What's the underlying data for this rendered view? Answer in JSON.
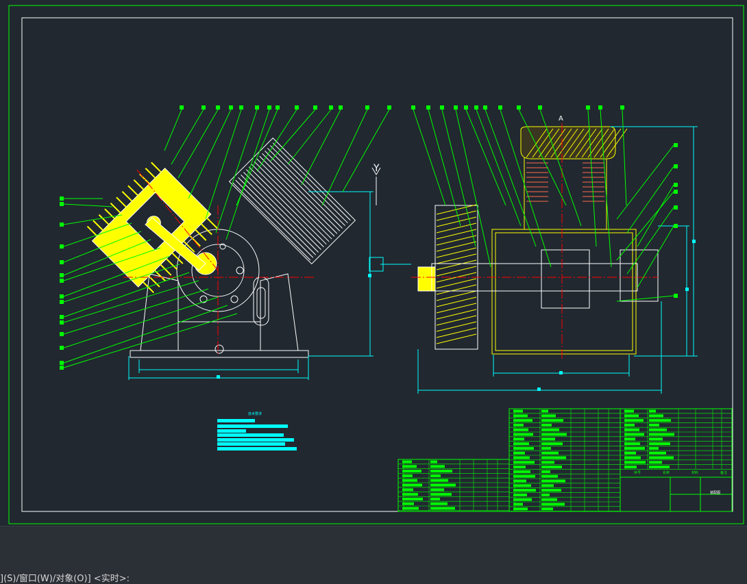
{
  "colors": {
    "background": "#212830",
    "frame": "#00ff00",
    "border": "#ffffff",
    "part_fill": "#ffff00",
    "dimension": "#00ffff",
    "centerline": "#ff0000",
    "hatch": "#ffff00",
    "leader": "#00ff00",
    "section_line": "#ffffff",
    "highlight": "#ff00ff"
  },
  "drawing": {
    "view_left_label": "Y",
    "view_left_sublabel": "↓",
    "view_right_label": "A"
  },
  "tech_notes": {
    "title": "技术要求"
  },
  "title_block": {
    "drawing_name": "装配图"
  },
  "parts_table_headers": [
    "序号",
    "名称",
    "材料",
    "备注"
  ],
  "command_line": {
    "text": "](S)/窗口(W)/对象(O)] <实时>:"
  }
}
